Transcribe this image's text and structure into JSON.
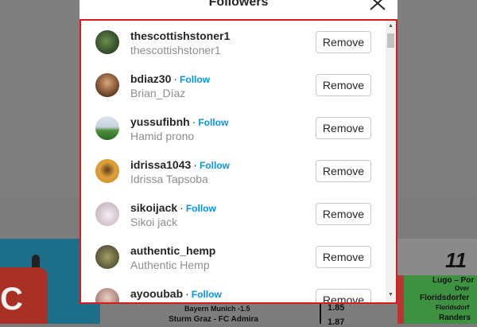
{
  "modal": {
    "title": "Followers",
    "close_icon": "close-icon",
    "follow_label": "Follow",
    "remove_label": "Remove",
    "separator": "·"
  },
  "followers": [
    {
      "username": "thescottishstoner1",
      "full_name": "thescottishstoner1",
      "show_follow": false
    },
    {
      "username": "bdiaz30",
      "full_name": "Brian_Díaz",
      "show_follow": true
    },
    {
      "username": "yussufibnh",
      "full_name": "Hamid prono",
      "show_follow": true
    },
    {
      "username": "idrissa1043",
      "full_name": "Idrissa Tapsoba",
      "show_follow": true
    },
    {
      "username": "sikoijack",
      "full_name": "Sikoi jack",
      "show_follow": true
    },
    {
      "username": "authentic_hemp",
      "full_name": "Authentic Hemp",
      "show_follow": false
    },
    {
      "username": "ayooubab",
      "full_name": "",
      "show_follow": true
    }
  ],
  "background": {
    "card_letter": "C",
    "right_number": "11",
    "right_lines": [
      "Lugo – Por",
      "Over",
      "Floridsdorfer",
      "Floridsdorf",
      "Randers"
    ],
    "center_lines": [
      "Bayern Munich -1.5",
      "Sturm Graz - FC Admira",
      "1.85",
      "1.87"
    ]
  },
  "colors": {
    "accent": "#0095f6",
    "highlight_border": "#d61b1b"
  }
}
